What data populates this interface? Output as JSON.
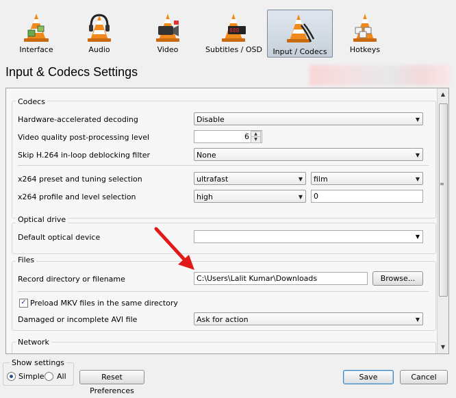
{
  "toolbar": {
    "items": [
      {
        "label": "Interface",
        "icon": "interface-icon"
      },
      {
        "label": "Audio",
        "icon": "audio-icon"
      },
      {
        "label": "Video",
        "icon": "video-icon"
      },
      {
        "label": "Subtitles / OSD",
        "icon": "subtitles-icon"
      },
      {
        "label": "Input / Codecs",
        "icon": "input-codecs-icon",
        "selected": true
      },
      {
        "label": "Hotkeys",
        "icon": "hotkeys-icon"
      }
    ]
  },
  "page": {
    "title": "Input & Codecs Settings"
  },
  "codecs": {
    "title": "Codecs",
    "hw_decoding_label": "Hardware-accelerated decoding",
    "hw_decoding_value": "Disable",
    "postproc_label": "Video quality post-processing level",
    "postproc_value": "6",
    "skip_h264_label": "Skip H.264 in-loop deblocking filter",
    "skip_h264_value": "None",
    "x264_preset_label": "x264 preset and tuning selection",
    "x264_preset_value": "ultrafast",
    "x264_tune_value": "film",
    "x264_profile_label": "x264 profile and level selection",
    "x264_profile_value": "high",
    "x264_level_value": "0"
  },
  "optical": {
    "title": "Optical drive",
    "device_label": "Default optical device",
    "device_value": ""
  },
  "files": {
    "title": "Files",
    "record_label": "Record directory or filename",
    "record_value": "C:\\Users\\Lalit Kumar\\Downloads",
    "browse_label": "Browse...",
    "preload_mkv_label": "Preload MKV files in the same directory",
    "preload_mkv_checked": true,
    "avi_label": "Damaged or incomplete AVI file",
    "avi_value": "Ask for action"
  },
  "network": {
    "title": "Network"
  },
  "bottom": {
    "show_settings_label": "Show settings",
    "simple_label": "Simple",
    "all_label": "All",
    "selected_mode": "Simple",
    "reset_label": "Reset Preferences",
    "save_label": "Save",
    "cancel_label": "Cancel"
  },
  "colors": {
    "cone_orange": "#f08a1c",
    "highlight_arrow": "#e11919",
    "selected_tab_bg": "#d2dae4"
  }
}
